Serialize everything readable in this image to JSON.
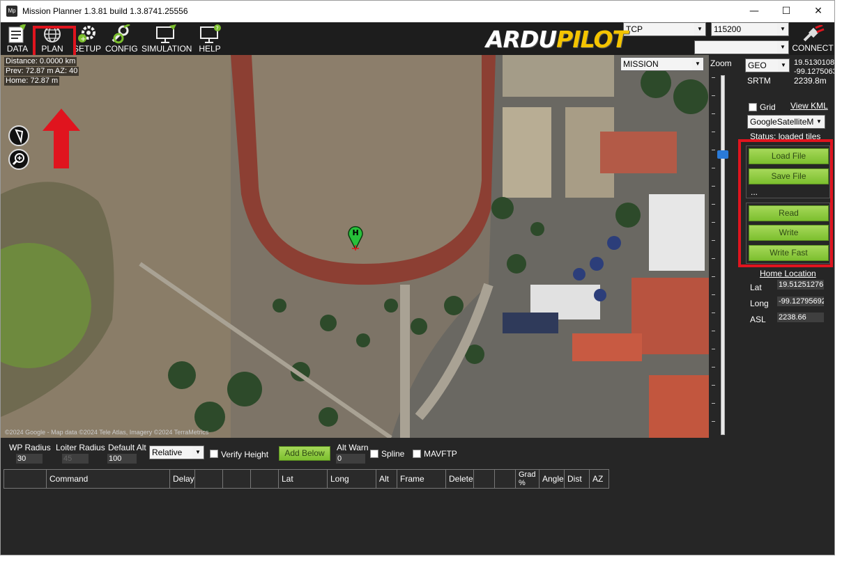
{
  "window": {
    "title": "Mission Planner 1.3.81 build 1.3.8741.25556",
    "app_icon": "Mp",
    "min": "—",
    "max": "☐",
    "close": "✕"
  },
  "toolbar": {
    "items": [
      {
        "label": "DATA",
        "icon": "data-icon"
      },
      {
        "label": "PLAN",
        "icon": "globe-icon"
      },
      {
        "label": "SETUP",
        "icon": "gear-icon"
      },
      {
        "label": "CONFIG",
        "icon": "wrench-icon"
      },
      {
        "label": "SIMULATION",
        "icon": "monitor-icon"
      },
      {
        "label": "HELP",
        "icon": "help-monitor-icon"
      }
    ],
    "logo_part1": "ARDU",
    "logo_part2": "PILOT",
    "connection_type": "TCP",
    "baud_rate": "115200",
    "port": "",
    "connect_label": "CONNECT"
  },
  "map": {
    "distance": "Distance: 0.0000 km",
    "prev": "Prev: 72.87 m AZ: 40",
    "home": "Home: 72.87 m",
    "copyright": "©2024 Google - Map data ©2024 Tele Atlas, Imagery ©2024 TerraMetrics",
    "home_marker": "H"
  },
  "right": {
    "mode": "MISSION",
    "zoom_label": "Zoom",
    "coord_type": "GEO",
    "geo_lat": "19.5130108",
    "geo_lng": "-99.1275063",
    "srtm_label": "SRTM",
    "srtm_value": "2239.8m",
    "grid_label": "Grid",
    "view_kml": "View KML",
    "map_type": "GoogleSatelliteMap",
    "status": "Status: loaded tiles",
    "load_file": "Load File",
    "save_file": "Save File",
    "ellipsis": "...",
    "read": "Read",
    "write": "Write",
    "write_fast": "Write Fast",
    "home_location": "Home Location",
    "lat_label": "Lat",
    "lat_value": "19.51251276",
    "long_label": "Long",
    "long_value": "-99.12795692",
    "asl_label": "ASL",
    "asl_value": "2238.66",
    "collapse": "v"
  },
  "bottom": {
    "wp_radius_label": "WP Radius",
    "wp_radius": "30",
    "loiter_radius_label": "Loiter Radius",
    "loiter_radius": "45",
    "default_alt_label": "Default Alt",
    "default_alt": "100",
    "alt_frame": "Relative",
    "verify_height": "Verify Height",
    "add_below": "Add Below",
    "alt_warn_label": "Alt Warn",
    "alt_warn": "0",
    "spline": "Spline",
    "mavftp": "MAVFTP",
    "columns": [
      "",
      "Command",
      "Delay",
      "",
      "",
      "",
      "Lat",
      "Long",
      "Alt",
      "Frame",
      "Delete",
      "",
      "",
      "Grad %",
      "Angle",
      "Dist",
      "AZ"
    ]
  },
  "colors": {
    "accent_green": "#8dc63f",
    "highlight_red": "#e0141e",
    "logo_yellow": "#f4c400"
  }
}
